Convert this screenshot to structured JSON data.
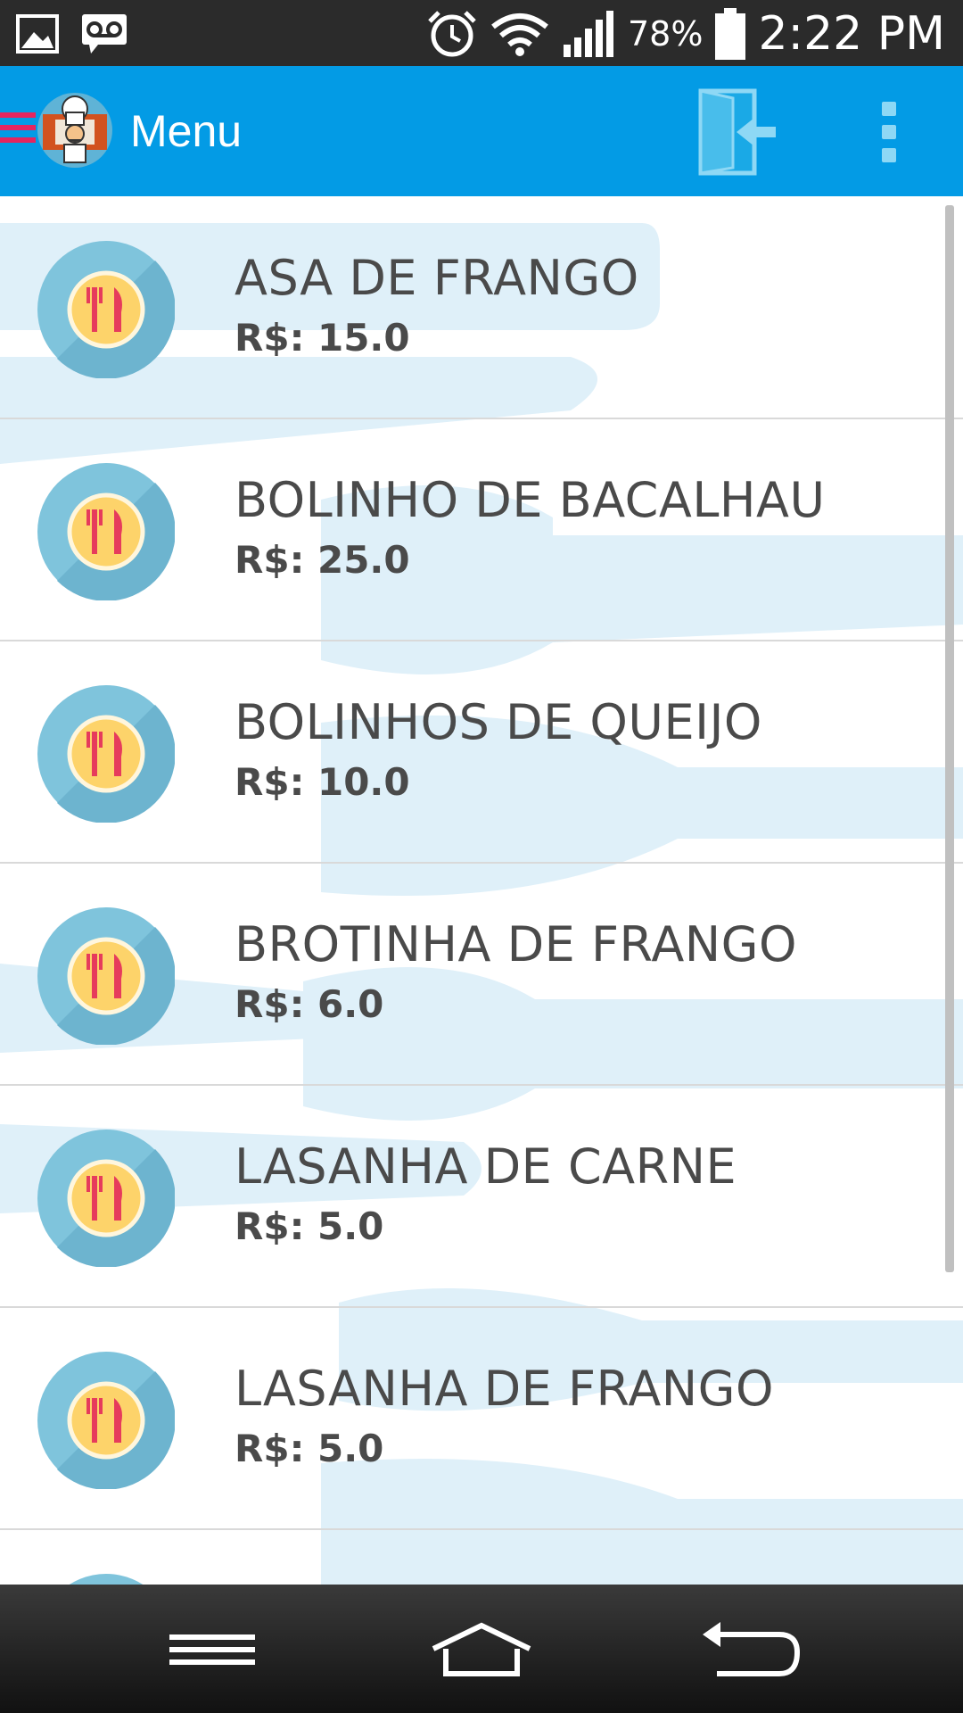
{
  "status_bar": {
    "battery_pct": "78%",
    "clock": "2:22 PM",
    "icons": [
      "image-icon",
      "voicemail-icon",
      "alarm-icon",
      "wifi-icon",
      "signal-icon",
      "battery-icon"
    ]
  },
  "app_bar": {
    "title": "Menu",
    "icons": [
      "drawer-menu-icon",
      "chef-logo-icon",
      "logout-icon",
      "overflow-menu-icon"
    ],
    "colors": {
      "background": "#039be5",
      "drawer": "#e5255f"
    }
  },
  "menu_items": [
    {
      "name": "ASA DE FRANGO",
      "price": "R$: 15.0"
    },
    {
      "name": "BOLINHO DE BACALHAU",
      "price": "R$: 25.0"
    },
    {
      "name": "BOLINHOS DE QUEIJO",
      "price": "R$: 10.0"
    },
    {
      "name": "BROTINHA DE FRANGO",
      "price": "R$: 6.0"
    },
    {
      "name": "LASANHA DE CARNE",
      "price": "R$: 5.0"
    },
    {
      "name": "LASANHA DE FRANGO",
      "price": "R$: 5.0"
    }
  ],
  "nav_bar": {
    "icons": [
      "recent-apps-icon",
      "home-icon",
      "back-icon"
    ]
  }
}
